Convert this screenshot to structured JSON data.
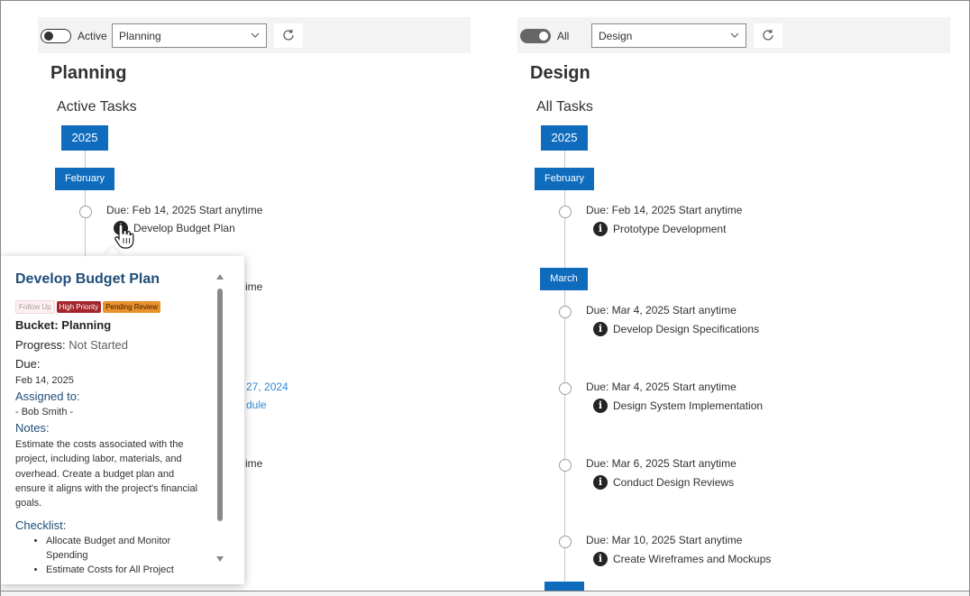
{
  "left": {
    "toolbar": {
      "toggle_on": false,
      "toggle_label": "Active",
      "select_value": "Planning"
    },
    "title": "Planning",
    "subtitle": "Active Tasks",
    "year": "2025",
    "month": "February",
    "task": {
      "due": "Due: Feb 14, 2025  Start anytime",
      "title": "Develop Budget Plan"
    },
    "hidden_fragments": {
      "f1": "ime",
      "f2": "27, 2024",
      "f3": "dule",
      "f4": "ime"
    }
  },
  "popup": {
    "title": "Develop Budget Plan",
    "tags": [
      "Follow Up",
      "High Priority",
      "Pending Review"
    ],
    "bucket": "Bucket: Planning",
    "progress_label": "Progress:",
    "progress_value": "Not Started",
    "due_label": "Due:",
    "due_value": "Feb 14, 2025",
    "assigned_label": "Assigned to:",
    "assigned_value": "- Bob Smith -",
    "notes_label": "Notes:",
    "notes_value": "Estimate the costs associated with the project, including labor, materials, and overhead. Create a budget plan and ensure it aligns with the project's financial goals.",
    "checklist_label": "Checklist:",
    "checklist": [
      "Allocate Budget and Monitor Spending",
      "Estimate Costs for All Project"
    ]
  },
  "right": {
    "toolbar": {
      "toggle_on": true,
      "toggle_label": "All",
      "select_value": "Design"
    },
    "title": "Design",
    "subtitle": "All Tasks",
    "year": "2025",
    "months": [
      "February",
      "March"
    ],
    "tasks": [
      {
        "due": "Due: Feb 14, 2025  Start anytime",
        "title": "Prototype Development"
      },
      {
        "due": "Due: Mar 4, 2025  Start anytime",
        "title": "Develop Design Specifications"
      },
      {
        "due": "Due: Mar 4, 2025  Start anytime",
        "title": "Design System Implementation"
      },
      {
        "due": "Due: Mar 6, 2025  Start anytime",
        "title": "Conduct Design Reviews"
      },
      {
        "due": "Due: Mar 10, 2025  Start anytime",
        "title": "Create Wireframes and Mockups"
      }
    ]
  },
  "icons": {
    "info": "info-icon",
    "refresh": "refresh-icon",
    "chevron": "chevron-down-icon",
    "cursor": "hand-pointer-icon"
  }
}
